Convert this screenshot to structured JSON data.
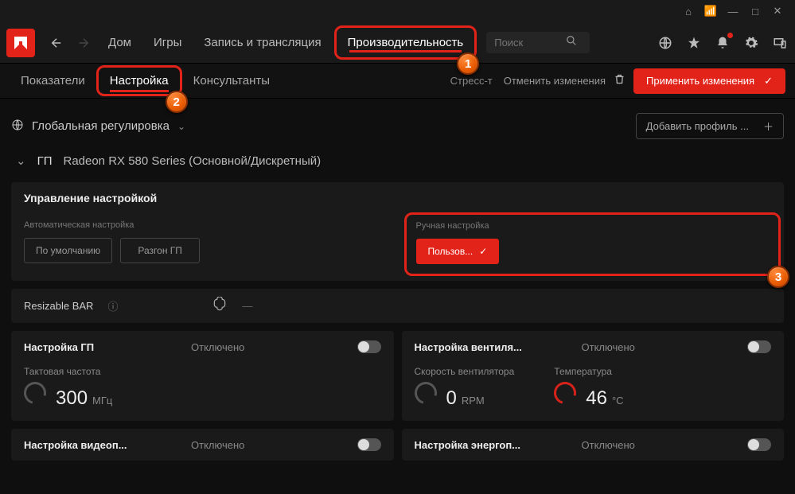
{
  "titlebar": {
    "bug": "⚙",
    "min": "—",
    "max": "□",
    "close": "✕"
  },
  "topnav": {
    "back": "‹",
    "forward": "›",
    "items": [
      "Дом",
      "Игры",
      "Запись и трансляция",
      "Производительность"
    ],
    "search_placeholder": "Поиск"
  },
  "subnav": {
    "items": [
      "Показатели",
      "Настройка",
      "Консультанты"
    ],
    "stress": "Стресс-т",
    "cancel": "Отменить изменения",
    "apply": "Применить изменения"
  },
  "profile": {
    "global": "Глобальная регулировка",
    "add": "Добавить профиль ..."
  },
  "gpu": {
    "label": "ГП",
    "name": "Radeon RX 580 Series (Основной/Дискретный)"
  },
  "tuning": {
    "header": "Управление настройкой",
    "auto_label": "Автоматическая настройка",
    "btn_default": "По умолчанию",
    "btn_oc": "Разгон ГП",
    "manual_label": "Ручная настройка",
    "btn_custom": "Пользов..."
  },
  "rbar": {
    "label": "Resizable BAR",
    "value": "—"
  },
  "cards": {
    "gpu_tune": {
      "title": "Настройка ГП",
      "status": "Отключено",
      "clock_label": "Тактовая частота",
      "clock_val": "300",
      "clock_unit": "МГц"
    },
    "fan_tune": {
      "title": "Настройка вентиля...",
      "status": "Отключено",
      "fan_label": "Скорость вентилятора",
      "fan_val": "0",
      "fan_unit": "RPM",
      "temp_label": "Температура",
      "temp_val": "46",
      "temp_unit": "°C"
    },
    "vram": {
      "title": "Настройка видеоп...",
      "status": "Отключено"
    },
    "power": {
      "title": "Настройка энергоп...",
      "status": "Отключено"
    }
  },
  "badges": {
    "b1": "1",
    "b2": "2",
    "b3": "3"
  }
}
